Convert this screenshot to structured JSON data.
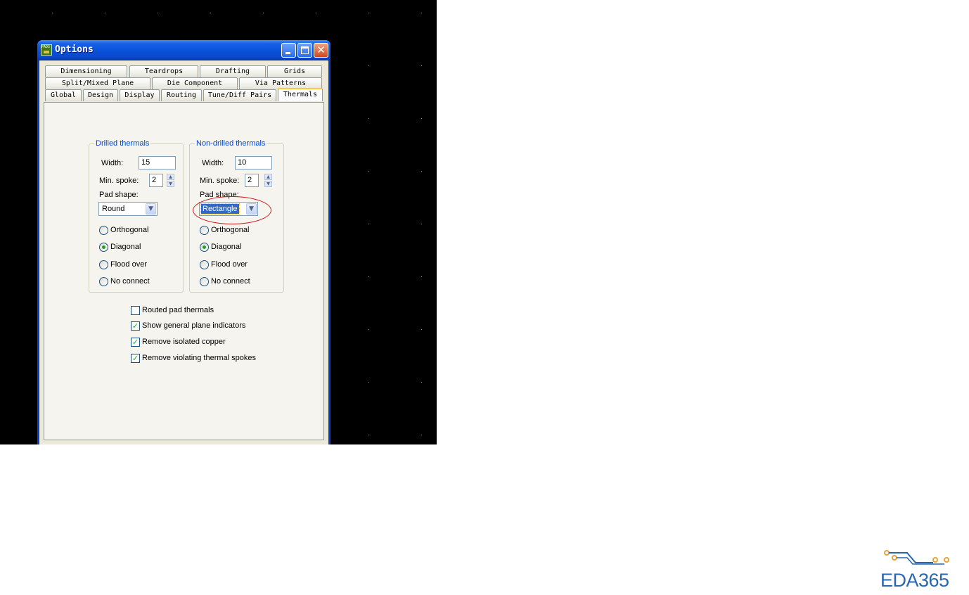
{
  "window": {
    "title": "Options",
    "app_icon_text": "PADS"
  },
  "tabs": {
    "row1": [
      "Dimensioning",
      "Teardrops",
      "Drafting",
      "Grids"
    ],
    "row2": [
      "Split/Mixed Plane",
      "Die Component",
      "Via Patterns"
    ],
    "row3": [
      "Global",
      "Design",
      "Display",
      "Routing",
      "Tune/Diff Pairs",
      "Thermals"
    ],
    "active": "Thermals"
  },
  "drilled": {
    "title": "Drilled thermals",
    "width_label": "Width:",
    "width_value": "15",
    "min_spoke_label": "Min. spoke:",
    "min_spoke_value": "2",
    "pad_shape_label": "Pad shape:",
    "pad_shape_value": "Round",
    "options": [
      "Orthogonal",
      "Diagonal",
      "Flood over",
      "No connect"
    ],
    "selected": "Diagonal"
  },
  "non_drilled": {
    "title": "Non-drilled thermals",
    "width_label": "Width:",
    "width_value": "10",
    "min_spoke_label": "Min. spoke:",
    "min_spoke_value": "2",
    "pad_shape_label": "Pad shape:",
    "pad_shape_value": "Rectangle",
    "options": [
      "Orthogonal",
      "Diagonal",
      "Flood over",
      "No connect"
    ],
    "selected": "Diagonal"
  },
  "checkboxes": [
    {
      "label": "Routed pad thermals",
      "checked": false
    },
    {
      "label": "Show general plane indicators",
      "checked": true
    },
    {
      "label": "Remove isolated copper",
      "checked": true
    },
    {
      "label": "Remove violating thermal spokes",
      "checked": true
    }
  ],
  "watermark": {
    "text": "EDA365"
  },
  "colors": {
    "titlebar": "#0a50d9",
    "group_title": "#0046d5",
    "annotation": "#d01818",
    "watermark": "#2867ad",
    "logo_accent": "#e8a23a"
  }
}
